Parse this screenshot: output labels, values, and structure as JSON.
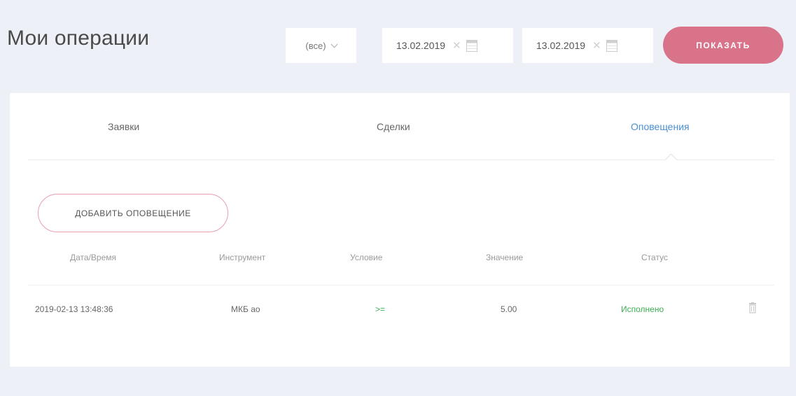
{
  "header": {
    "title": "Мои операции",
    "filter_select": "(все)",
    "date_from": "13.02.2019",
    "date_to": "13.02.2019",
    "show_button": "ПОКАЗАТЬ"
  },
  "tabs": [
    {
      "label": "Заявки",
      "active": false
    },
    {
      "label": "Сделки",
      "active": false
    },
    {
      "label": "Оповещения",
      "active": true
    }
  ],
  "add_button": "ДОБАВИТЬ ОПОВЕЩЕНИЕ",
  "table": {
    "columns": [
      "Дата/Время",
      "Инструмент",
      "Условие",
      "Значение",
      "Статус"
    ],
    "rows": [
      {
        "datetime": "2019-02-13 13:48:36",
        "instrument": "МКБ ао",
        "condition": ">=",
        "value": "5.00",
        "status": "Исполнено"
      }
    ]
  },
  "colors": {
    "accent": "#d9738a",
    "active_tab": "#4a8fd1",
    "status_done": "#3cae52",
    "background": "#eef0f7"
  }
}
